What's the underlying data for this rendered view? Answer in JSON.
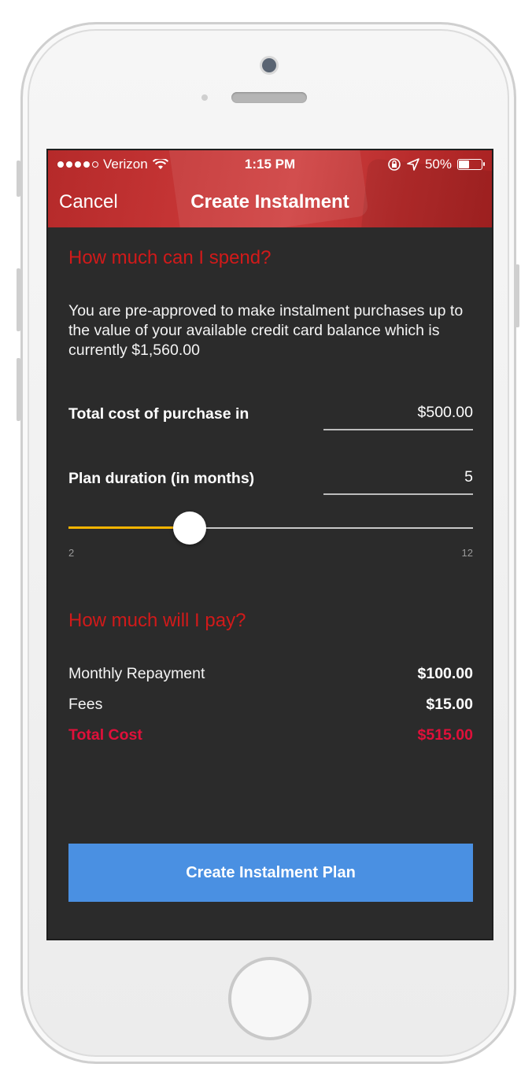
{
  "status_bar": {
    "carrier": "Verizon",
    "time": "1:15 PM",
    "battery": "50%",
    "battery_level": 0.5
  },
  "nav": {
    "cancel_label": "Cancel",
    "title": "Create Instalment"
  },
  "spend_section": {
    "title": "How much can I spend?",
    "description": "You are pre-approved to make instalment purchases up to the value of your available credit card balance which is currently $1,560.00"
  },
  "purchase_field": {
    "label": "Total cost of purchase in",
    "value": "$500.00"
  },
  "duration_field": {
    "label": "Plan duration (in months)",
    "value": "5"
  },
  "slider": {
    "min_label": "2",
    "max_label": "12",
    "min": 2,
    "max": 12,
    "value": 5,
    "fill_color": "#f5b400"
  },
  "pay_section": {
    "title": "How much will I pay?",
    "rows": [
      {
        "label": "Monthly Repayment",
        "value": "$100.00"
      },
      {
        "label": "Fees",
        "value": "$15.00"
      },
      {
        "label": "Total Cost",
        "value": "$515.00"
      }
    ]
  },
  "cta": {
    "label": "Create Instalment Plan",
    "color": "#4a90e2"
  },
  "colors": {
    "header_red": "#c73636",
    "section_title_red": "#d11a1a",
    "total_red": "#e0103a",
    "background": "#2b2b2b"
  }
}
